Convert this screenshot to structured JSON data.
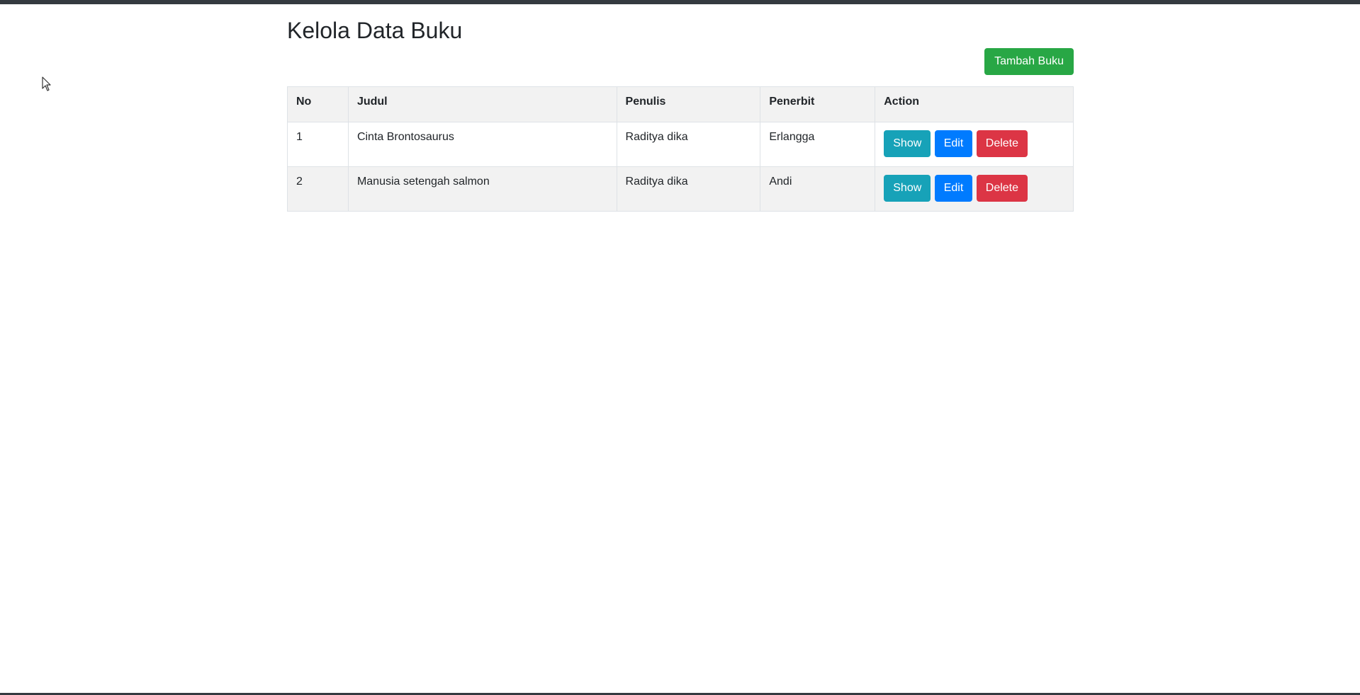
{
  "page": {
    "title": "Kelola Data Buku",
    "add_button_label": "Tambah Buku"
  },
  "table": {
    "headers": {
      "no": "No",
      "judul": "Judul",
      "penulis": "Penulis",
      "penerbit": "Penerbit",
      "action": "Action"
    },
    "rows": [
      {
        "no": "1",
        "judul": "Cinta Brontosaurus",
        "penulis": "Raditya dika",
        "penerbit": "Erlangga",
        "show_label": "Show",
        "edit_label": "Edit",
        "delete_label": "Delete"
      },
      {
        "no": "2",
        "judul": "Manusia setengah salmon",
        "penulis": "Raditya dika",
        "penerbit": "Andi",
        "show_label": "Show",
        "edit_label": "Edit",
        "delete_label": "Delete"
      }
    ]
  },
  "colors": {
    "top_bar": "#343a40",
    "success": "#28a745",
    "info": "#17a2b8",
    "primary": "#007bff",
    "danger": "#dc3545",
    "striped_row": "#f2f2f2"
  },
  "icons": {
    "cursor": "mouse-pointer-icon"
  }
}
